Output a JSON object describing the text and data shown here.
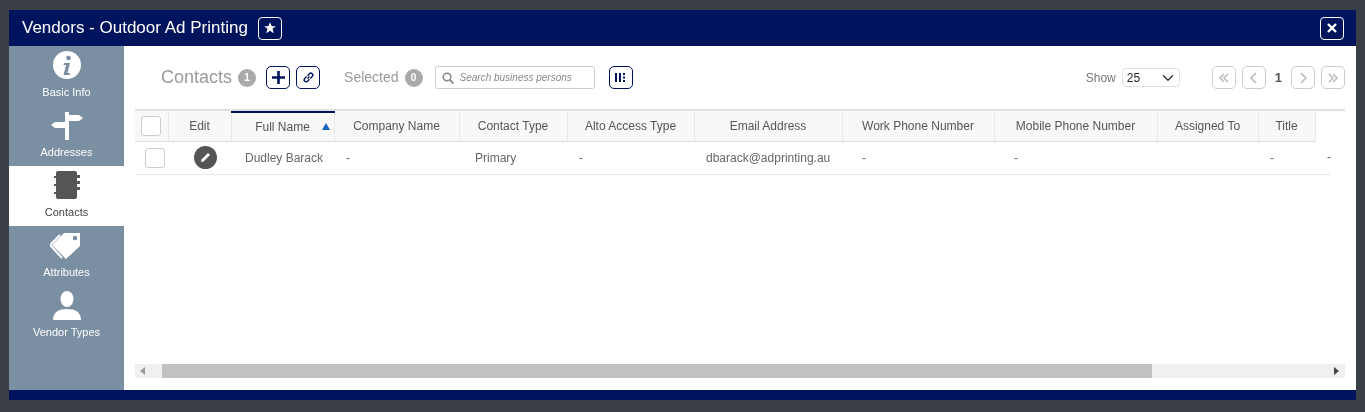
{
  "window": {
    "title": "Vendors - Outdoor Ad Printing",
    "favorite": true
  },
  "sidebar": {
    "items": [
      {
        "label": "Basic Info",
        "kind": "info",
        "selected": false
      },
      {
        "label": "Addresses",
        "kind": "signpost",
        "selected": false
      },
      {
        "label": "Contacts",
        "kind": "addressbook",
        "selected": true
      },
      {
        "label": "Attributes",
        "kind": "tags",
        "selected": false
      },
      {
        "label": "Vendor Types",
        "kind": "person",
        "selected": false
      }
    ]
  },
  "toolbar": {
    "title": "Contacts",
    "count": "1",
    "selected_label": "Selected",
    "selected_count": "0",
    "search": {
      "placeholder": "Search business persons"
    },
    "show_label": "Show",
    "page_size": "25",
    "page": "1",
    "pager_disabled": true
  },
  "table": {
    "select_all_checked": false,
    "columns": [
      {
        "label": "Edit",
        "sorted": false
      },
      {
        "label": "Full Name",
        "sorted": true
      },
      {
        "label": "Company Name",
        "sorted": false
      },
      {
        "label": "Contact Type",
        "sorted": false
      },
      {
        "label": "Alto Access Type",
        "sorted": false
      },
      {
        "label": "Email Address",
        "sorted": false
      },
      {
        "label": "Work Phone Number",
        "sorted": false
      },
      {
        "label": "Mobile Phone Number",
        "sorted": false
      },
      {
        "label": "Assigned To",
        "sorted": false
      },
      {
        "label": "Title",
        "sorted": false
      }
    ],
    "rows": [
      {
        "checked": false,
        "cells": [
          {
            "kind": "edit"
          },
          {
            "kind": "text",
            "text": "Dudley Barack"
          },
          {
            "kind": "text",
            "text": "-"
          },
          {
            "kind": "text",
            "text": "Primary"
          },
          {
            "kind": "text",
            "text": "-"
          },
          {
            "kind": "text",
            "text": "dbarack@adprinting.au"
          },
          {
            "kind": "text",
            "text": "-"
          },
          {
            "kind": "text",
            "text": "-"
          },
          {
            "kind": "empty"
          },
          {
            "kind": "text",
            "text": "-"
          },
          {
            "kind": "text",
            "text": "-"
          }
        ]
      }
    ]
  }
}
